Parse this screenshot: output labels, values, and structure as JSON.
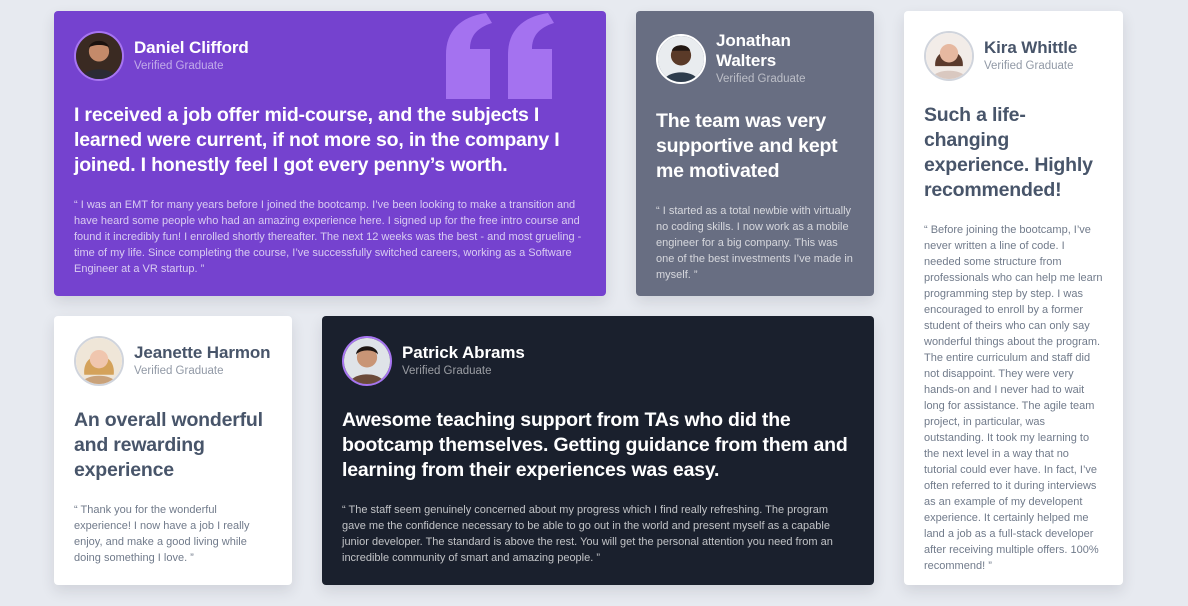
{
  "colors": {
    "background": "#e7eaf0",
    "purple": "#7542cf",
    "gray": "#686e82",
    "white": "#ffffff",
    "dark": "#1a202d",
    "accent_quote": "#a775f1"
  },
  "testimonials": [
    {
      "name": "Daniel Clifford",
      "role": "Verified Graduate",
      "headline": "I received a job offer mid-course, and the subjects I learned were current, if not more so, in the company I joined. I honestly feel I got every penny’s worth.",
      "body": "“ I was an EMT for many years before I joined the bootcamp. I’ve been looking to make a transition and have heard some people who had an amazing experience here. I signed up for the free intro course and found it incredibly fun! I enrolled shortly thereafter. The next 12 weeks was the best - and most grueling - time of my life. Since completing the course, I’ve successfully switched careers, working as a Software Engineer at a VR startup. ”",
      "avatar_icon": "avatar-daniel"
    },
    {
      "name": "Jonathan Walters",
      "role": "Verified Graduate",
      "headline": "The team was very supportive and kept me motivated",
      "body": "“ I started as a total newbie with virtually no coding skills. I now work as a mobile engineer for a big company. This was one of the best investments I’ve made in myself. ”",
      "avatar_icon": "avatar-jonathan"
    },
    {
      "name": "Kira Whittle",
      "role": "Verified Graduate",
      "headline": "Such a life-changing experience. Highly recommended!",
      "body": "“ Before joining the bootcamp, I’ve never written a line of code. I needed some structure from professionals who can help me learn programming step by step. I was encouraged to enroll by a former student of theirs who can only say wonderful things about the program. The entire curriculum and staff did not disappoint. They were very hands-on and I never had to wait long for assistance. The agile team project, in particular, was outstanding. It took my learning to the next level in a way that no tutorial could ever have. In fact, I’ve often referred to it during interviews as an example of my developent experience. It certainly helped me land a job as a full-stack developer after receiving multiple offers. 100% recommend! ”",
      "avatar_icon": "avatar-kira"
    },
    {
      "name": "Jeanette Harmon",
      "role": "Verified Graduate",
      "headline": "An overall wonderful and rewarding experience",
      "body": "“ Thank you for the wonderful experience! I now have a job I really enjoy, and make a good living while doing something I love. ”",
      "avatar_icon": "avatar-jeanette"
    },
    {
      "name": "Patrick Abrams",
      "role": "Verified Graduate",
      "headline": "Awesome teaching support from TAs who did the bootcamp themselves. Getting guidance from them and learning from their experiences was easy.",
      "body": "“ The staff seem genuinely concerned about my progress which I find really refreshing. The program gave me the confidence necessary to be able to go out in the world and present myself as a capable junior developer. The standard is above the rest. You will get the personal attention you need from an incredible community of smart and amazing people. ”",
      "avatar_icon": "avatar-patrick"
    }
  ]
}
